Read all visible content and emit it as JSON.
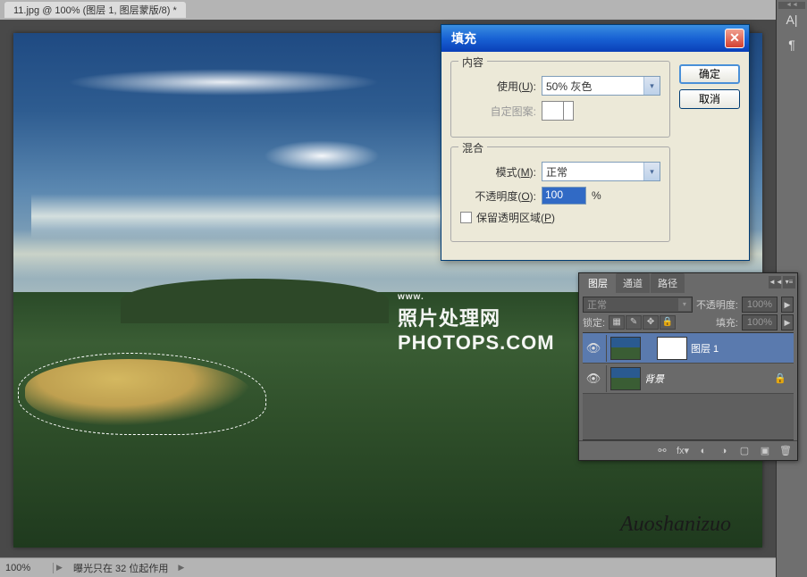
{
  "tab": {
    "title": "11.jpg @ 100% (图层 1, 图层蒙版/8) *"
  },
  "watermark": {
    "www": "www.",
    "site_cn": "照片处理网",
    "site_en": "PHOTOPS.COM"
  },
  "signature": "Auoshanizuo",
  "right_tools": {
    "t1": "A|",
    "t2": "¶"
  },
  "dialog": {
    "title": "填充",
    "ok": "确定",
    "cancel": "取消",
    "content_legend": "内容",
    "use_label": "使用(",
    "use_u": "U",
    "use_suffix": "):",
    "use_value": "50% 灰色",
    "pattern_label": "自定图案:",
    "blend_legend": "混合",
    "mode_label": "模式(",
    "mode_u": "M",
    "mode_suffix": "):",
    "mode_value": "正常",
    "opacity_label": "不透明度(",
    "opacity_u": "O",
    "opacity_suffix": "):",
    "opacity_value": "100",
    "opacity_unit": "%",
    "preserve_label": "保留透明区域(",
    "preserve_u": "P",
    "preserve_suffix": ")"
  },
  "panel": {
    "tabs": {
      "layers": "图层",
      "channels": "通道",
      "paths": "路径"
    },
    "blend_mode": "正常",
    "opacity_label": "不透明度:",
    "opacity_value": "100%",
    "lock_label": "锁定:",
    "fill_label": "填充:",
    "fill_value": "100%",
    "layer1_name": "图层 1",
    "bg_name": "背景"
  },
  "status": {
    "zoom": "100%",
    "info": "曝光只在 32 位起作用"
  }
}
